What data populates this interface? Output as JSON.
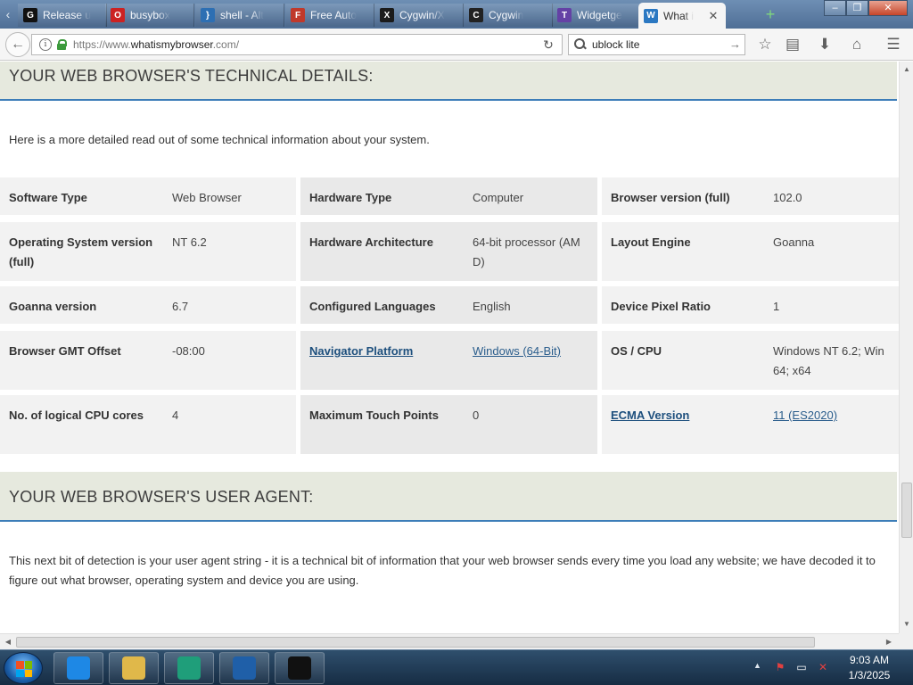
{
  "browser": {
    "tabs": [
      {
        "title": "Release u",
        "icon": "github-icon",
        "color": "#111111",
        "glyph": "G"
      },
      {
        "title": "busybox",
        "icon": "opera-icon",
        "color": "#cc2222",
        "glyph": "O"
      },
      {
        "title": "shell - Alt",
        "icon": "braces-icon",
        "color": "#2d6fb3",
        "glyph": "}"
      },
      {
        "title": "Free Auto",
        "icon": "document-icon",
        "color": "#c0392b",
        "glyph": "F"
      },
      {
        "title": "Cygwin/X",
        "icon": "cygwin-x-icon",
        "color": "#1b1b1b",
        "glyph": "X"
      },
      {
        "title": "Cygwin",
        "icon": "cygwin-icon",
        "color": "#222222",
        "glyph": "C"
      },
      {
        "title": "Widgetge",
        "icon": "twitch-icon",
        "color": "#6441a5",
        "glyph": "T"
      },
      {
        "title": "What i",
        "icon": "globe-icon",
        "color": "#2b78c2",
        "glyph": "W"
      }
    ],
    "url": {
      "prefix": "https://www.",
      "host": "whatismybrowser",
      "suffix": ".com/"
    },
    "search": {
      "value": "ublock lite",
      "placeholder": "Search"
    }
  },
  "page": {
    "tech_details_title": "YOUR WEB BROWSER'S TECHNICAL DETAILS:",
    "tech_intro": "Here is a more detailed read out of some technical information about your system.",
    "details": [
      [
        {
          "label": "Software Type",
          "value": "Web Browser"
        },
        {
          "label": "Hardware Type",
          "value": "Computer"
        },
        {
          "label": "Browser version (full)",
          "value": "102.0"
        }
      ],
      [
        {
          "label": "Operating System version (full)",
          "value": "NT 6.2"
        },
        {
          "label": "Hardware Architecture",
          "value": "64-bit processor (AMD)"
        },
        {
          "label": "Layout Engine",
          "value": "Goanna"
        }
      ],
      [
        {
          "label": "Goanna version",
          "value": "6.7"
        },
        {
          "label": "Configured Languages",
          "value": "English"
        },
        {
          "label": "Device Pixel Ratio",
          "value": "1"
        }
      ],
      [
        {
          "label": "Browser GMT Offset",
          "value": "-08:00"
        },
        {
          "label": "Navigator Platform",
          "value": "Windows (64-Bit)",
          "link": true
        },
        {
          "label": "OS / CPU",
          "value": "Windows NT 6.2; Win64; x64"
        }
      ],
      [
        {
          "label": "No. of logical CPU cores",
          "value": "4"
        },
        {
          "label": "Maximum Touch Points",
          "value": "0"
        },
        {
          "label": "ECMA Version",
          "value": "11 (ES2020)",
          "link": true
        }
      ]
    ],
    "user_agent_title": "YOUR WEB BROWSER'S USER AGENT:",
    "user_agent_intro": "This next bit of detection is your user agent string - it is a technical bit of information that your web browser sends every time you load any website; we have decoded it to figure out what browser, operating system and device you are using."
  },
  "taskbar": {
    "items": [
      {
        "name": "internet-explorer-icon",
        "color": "#1e88e5"
      },
      {
        "name": "file-explorer-icon",
        "color": "#e0b84a"
      },
      {
        "name": "browser-app-icon",
        "color": "#1f9e7a"
      },
      {
        "name": "powershell-icon",
        "color": "#1f5fa8"
      },
      {
        "name": "command-prompt-icon",
        "color": "#111111"
      }
    ],
    "clock": {
      "time": "9:03 AM",
      "date": "1/3/2025"
    }
  }
}
